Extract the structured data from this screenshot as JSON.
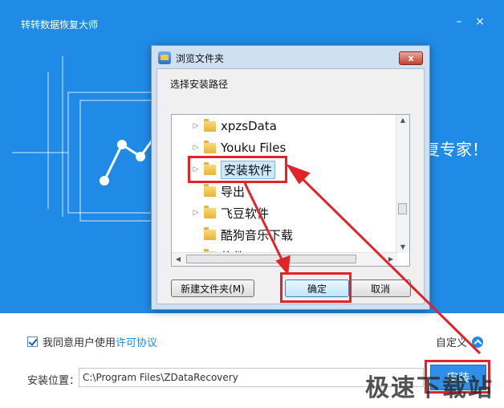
{
  "app": {
    "title": "转转数据恢复大师",
    "minimize": "–",
    "close": "×"
  },
  "hero": {
    "slogan": "复专家！"
  },
  "agreement": {
    "prefix": "我同意用户使用",
    "link": "许可协议",
    "checked": true
  },
  "options": {
    "custom_label": "自定义"
  },
  "install": {
    "path_label": "安装位置：",
    "path_value": "C:\\Program Files\\ZDataRecovery",
    "button_label": "安装"
  },
  "watermark": "极速下载站",
  "dialog": {
    "title": "浏览文件夹",
    "close_label": "x",
    "prompt": "选择安装路径",
    "tree": [
      {
        "label": "xpzsData",
        "expandable": true,
        "selected": false
      },
      {
        "label": "Youku Files",
        "expandable": true,
        "selected": false
      },
      {
        "label": "安装软件",
        "expandable": true,
        "selected": true
      },
      {
        "label": "导出",
        "expandable": false,
        "selected": false
      },
      {
        "label": "飞豆软件",
        "expandable": true,
        "selected": false
      },
      {
        "label": "酷狗音乐下载",
        "expandable": false,
        "selected": false
      },
      {
        "label": "软件",
        "expandable": false,
        "selected": false
      }
    ],
    "buttons": {
      "new_folder": "新建文件夹(M)",
      "ok": "确定",
      "cancel": "取消"
    }
  },
  "colors": {
    "hero": "#1f8be6",
    "highlight": "#e0242a",
    "selection": "#cde8fb"
  }
}
